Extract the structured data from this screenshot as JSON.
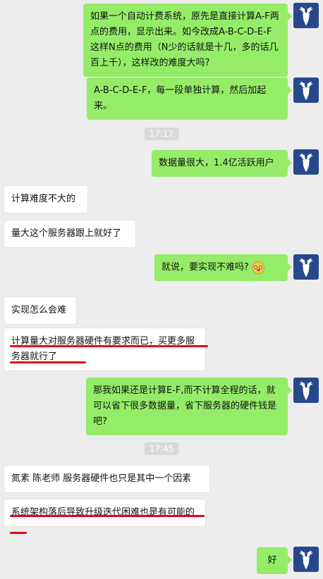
{
  "messages": [
    {
      "id": "m1",
      "dir": "out",
      "text": "如果一个自动计费系统，原先是直接计算A-F两点的费用，显示出来。如今改成A-B-C-D-E-F这样N点的费用（N少的话就是十几，多的话几百上千），这样改的难度大吗?"
    },
    {
      "id": "m2",
      "dir": "out",
      "text": "A-B-C-D-E-F，每一段单独计算，然后加起来。"
    },
    {
      "id": "t1",
      "type": "time",
      "text": "17:17"
    },
    {
      "id": "m3",
      "dir": "out",
      "text": "数据量很大，1.4亿活跃用户"
    },
    {
      "id": "m4",
      "dir": "in",
      "text": "计算难度不大的"
    },
    {
      "id": "m5",
      "dir": "in",
      "text": "量大这个服务器跟上就好了"
    },
    {
      "id": "m6",
      "dir": "out",
      "text": "就说，要实现不难吗?",
      "emoji": "flushed-face-icon"
    },
    {
      "id": "m7",
      "dir": "in",
      "text": "实现怎么会难"
    },
    {
      "id": "m8",
      "dir": "in",
      "text": "计算量大对服务器硬件有要求而已，买更多服务器就行了"
    },
    {
      "id": "m9",
      "dir": "out",
      "text": "那我如果还是计算E-F,而不计算全程的话，就可以省下很多数据量，省下服务器的硬件钱是吧?"
    },
    {
      "id": "t2",
      "type": "time",
      "text": "17:45"
    },
    {
      "id": "m10",
      "dir": "in",
      "text": "氮素 陈老师 服务器硬件也只是其中一个因素"
    },
    {
      "id": "m11",
      "dir": "in",
      "text": "系统架构落后导致升级迭代困难也是有可能的"
    },
    {
      "id": "m12",
      "dir": "out",
      "text": "好"
    }
  ],
  "colors": {
    "background": "#ededed",
    "outgoing_bubble": "#95ec69",
    "incoming_bubble": "#ffffff",
    "avatar": "#27498b",
    "annotation_underline": "#e8001c"
  },
  "avatar_icon": "deer-head-icon"
}
